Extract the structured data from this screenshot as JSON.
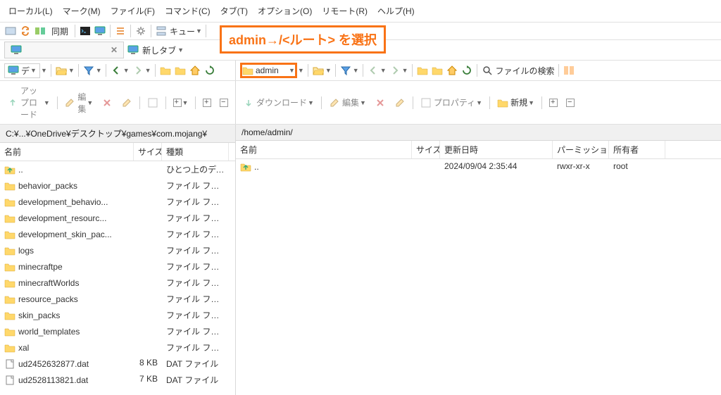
{
  "menu": [
    "ローカル(L)",
    "マーク(M)",
    "ファイル(F)",
    "コマンド(C)",
    "タブ(T)",
    "オプション(O)",
    "リモート(R)",
    "ヘルプ(H)"
  ],
  "toolbar": {
    "sync": "同期",
    "queue": "キュー",
    "callout": "admin→/<ルート> を選択"
  },
  "tabs": {
    "newtab": "新しタブ"
  },
  "nav": {
    "left_label": "デ",
    "right_label": "admin",
    "search": "ファイルの検索"
  },
  "actions": {
    "upload": "アップロード",
    "edit": "編集",
    "download": "ダウンロード",
    "edit2": "編集",
    "prop": "プロパティ",
    "new": "新規"
  },
  "left": {
    "path": "C:¥...¥OneDrive¥デスクトップ¥games¥com.mojang¥",
    "cols": {
      "name": "名前",
      "size": "サイズ",
      "type": "種類"
    },
    "name_w": 190,
    "size_w": 40,
    "type_w": 95,
    "items": [
      {
        "n": "..",
        "s": "",
        "t": "ひとつ上のディレク",
        "ico": "up"
      },
      {
        "n": "behavior_packs",
        "s": "",
        "t": "ファイル フォルダー",
        "ico": "folder"
      },
      {
        "n": "development_behavio...",
        "s": "",
        "t": "ファイル フォルダー",
        "ico": "folder"
      },
      {
        "n": "development_resourc...",
        "s": "",
        "t": "ファイル フォルダー",
        "ico": "folder"
      },
      {
        "n": "development_skin_pac...",
        "s": "",
        "t": "ファイル フォルダー",
        "ico": "folder"
      },
      {
        "n": "logs",
        "s": "",
        "t": "ファイル フォルダー",
        "ico": "folder"
      },
      {
        "n": "minecraftpe",
        "s": "",
        "t": "ファイル フォルダー",
        "ico": "folder"
      },
      {
        "n": "minecraftWorlds",
        "s": "",
        "t": "ファイル フォルダー",
        "ico": "folder"
      },
      {
        "n": "resource_packs",
        "s": "",
        "t": "ファイル フォルダー",
        "ico": "folder"
      },
      {
        "n": "skin_packs",
        "s": "",
        "t": "ファイル フォルダー",
        "ico": "folder"
      },
      {
        "n": "world_templates",
        "s": "",
        "t": "ファイル フォルダー",
        "ico": "folder"
      },
      {
        "n": "xal",
        "s": "",
        "t": "ファイル フォルダー",
        "ico": "folder"
      },
      {
        "n": "ud2452632877.dat",
        "s": "8 KB",
        "t": "DAT ファイル",
        "ico": "file"
      },
      {
        "n": "ud2528113821.dat",
        "s": "7 KB",
        "t": "DAT ファイル",
        "ico": "file"
      }
    ]
  },
  "right": {
    "path": "/home/admin/",
    "cols": {
      "name": "名前",
      "size": "サイズ",
      "date": "更新日時",
      "perm": "パーミッション",
      "owner": "所有者"
    },
    "name_w": 250,
    "size_w": 40,
    "date_w": 160,
    "perm_w": 80,
    "owner_w": 80,
    "items": [
      {
        "n": "..",
        "s": "",
        "d": "2024/09/04 2:35:44",
        "p": "rwxr-xr-x",
        "o": "root",
        "ico": "up"
      }
    ]
  }
}
